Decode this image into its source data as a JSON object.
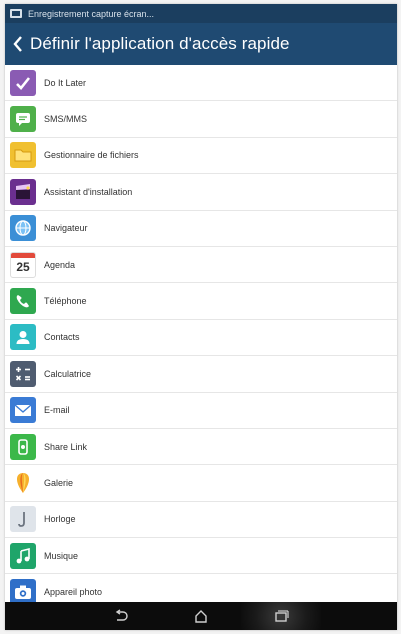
{
  "status_bar": {
    "notification_text": "Enregistrement capture écran..."
  },
  "header": {
    "title": "Définir l'application d'accès rapide"
  },
  "apps": [
    {
      "label": "Do It Later",
      "icon": "checkmark-icon",
      "color": "#8a5bb3"
    },
    {
      "label": "SMS/MMS",
      "icon": "message-icon",
      "color": "#4fb04a"
    },
    {
      "label": "Gestionnaire de fichiers",
      "icon": "folder-icon",
      "color": "#f0c030"
    },
    {
      "label": "Assistant d'installation",
      "icon": "clapperboard-icon",
      "color": "#6b2f8f"
    },
    {
      "label": "Navigateur",
      "icon": "globe-icon",
      "color": "#3b8fd6"
    },
    {
      "label": "Agenda",
      "icon": "calendar-icon",
      "color": "#e24a3b",
      "day": "25"
    },
    {
      "label": "Téléphone",
      "icon": "phone-icon",
      "color": "#2fa84f"
    },
    {
      "label": "Contacts",
      "icon": "contact-icon",
      "color": "#2cbcc4"
    },
    {
      "label": "Calculatrice",
      "icon": "calculator-icon",
      "color": "#4f5c70"
    },
    {
      "label": "E-mail",
      "icon": "mail-icon",
      "color": "#3a7bd5"
    },
    {
      "label": "Share Link",
      "icon": "share-link-icon",
      "color": "#3cb84a"
    },
    {
      "label": "Galerie",
      "icon": "gallery-icon",
      "color": "#f3a52a"
    },
    {
      "label": "Horloge",
      "icon": "clock-icon",
      "color": "#d8dde2"
    },
    {
      "label": "Musique",
      "icon": "music-icon",
      "color": "#1fa56a"
    },
    {
      "label": "Appareil photo",
      "icon": "camera-icon",
      "color": "#2f6fc8"
    }
  ],
  "nav": {
    "back_icon": "back-icon",
    "home_icon": "home-icon",
    "recents_icon": "recents-icon"
  }
}
